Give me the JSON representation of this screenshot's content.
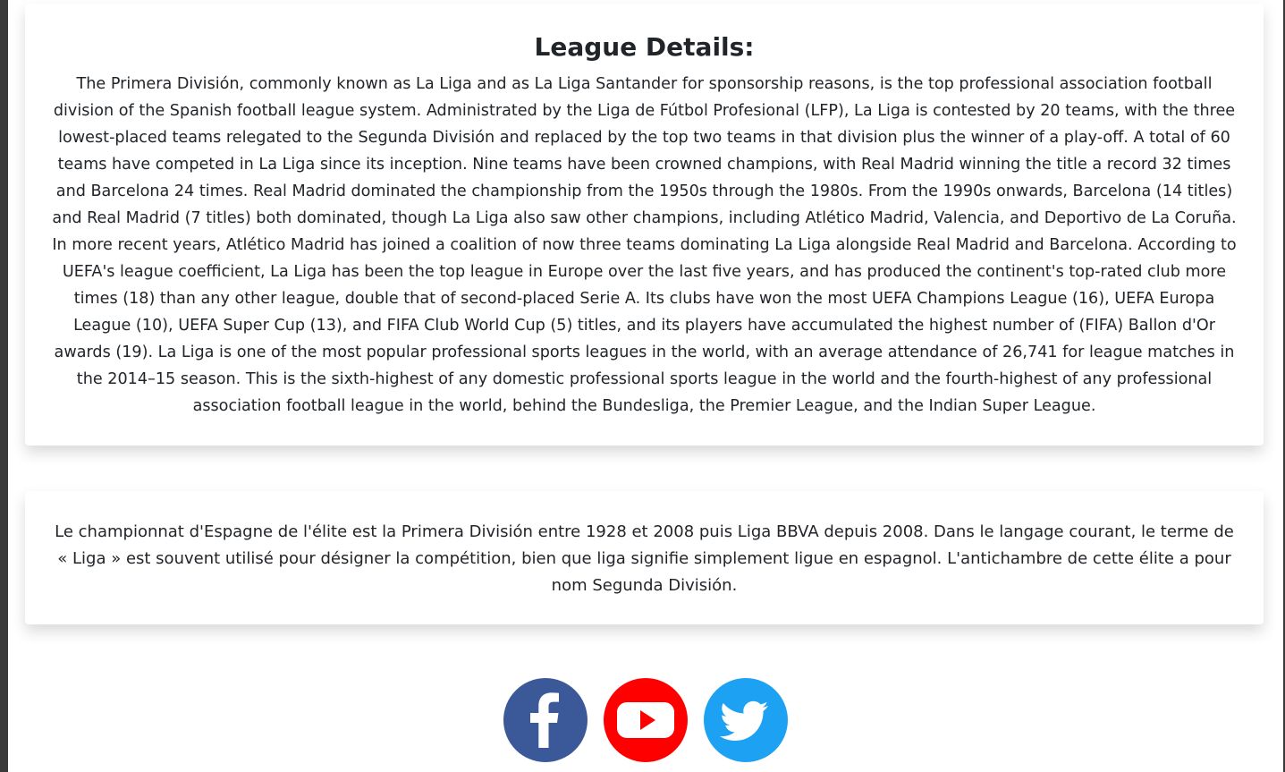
{
  "details": {
    "title": "League Details:",
    "body": "The Primera División, commonly known as La Liga and as La Liga Santander for sponsorship reasons, is the top professional association football division of the Spanish football league system. Administrated by the Liga de Fútbol Profesional (LFP), La Liga is contested by 20 teams, with the three lowest-placed teams relegated to the Segunda División and replaced by the top two teams in that division plus the winner of a play-off. A total of 60 teams have competed in La Liga since its inception. Nine teams have been crowned champions, with Real Madrid winning the title a record 32 times and Barcelona 24 times. Real Madrid dominated the championship from the 1950s through the 1980s. From the 1990s onwards, Barcelona (14 titles) and Real Madrid (7 titles) both dominated, though La Liga also saw other champions, including Atlético Madrid, Valencia, and Deportivo de La Coruña. In more recent years, Atlético Madrid has joined a coalition of now three teams dominating La Liga alongside Real Madrid and Barcelona. According to UEFA's league coefficient, La Liga has been the top league in Europe over the last five years, and has produced the continent's top-rated club more times (18) than any other league, double that of second-placed Serie A. Its clubs have won the most UEFA Champions League (16), UEFA Europa League (10), UEFA Super Cup (13), and FIFA Club World Cup (5) titles, and its players have accumulated the highest number of (FIFA) Ballon d'Or awards (19). La Liga is one of the most popular professional sports leagues in the world, with an average attendance of 26,741 for league matches in the 2014–15 season. This is the sixth-highest of any domestic professional sports league in the world and the fourth-highest of any professional association football league in the world, behind the Bundesliga, the Premier League, and the Indian Super League."
  },
  "french": {
    "body": "Le championnat d'Espagne de l'élite est la Primera División entre 1928 et 2008 puis Liga BBVA depuis 2008. Dans le langage courant, le terme de « Liga » est souvent utilisé pour désigner la compétition, bien que liga signifie simplement ligue en espagnol. L'antichambre de cette élite a pour nom Segunda División."
  },
  "social": [
    {
      "icon": "facebook-icon",
      "color": "#3b5998"
    },
    {
      "icon": "youtube-icon",
      "color": "#ff0000"
    },
    {
      "icon": "twitter-icon",
      "color": "#1da1f2"
    }
  ]
}
